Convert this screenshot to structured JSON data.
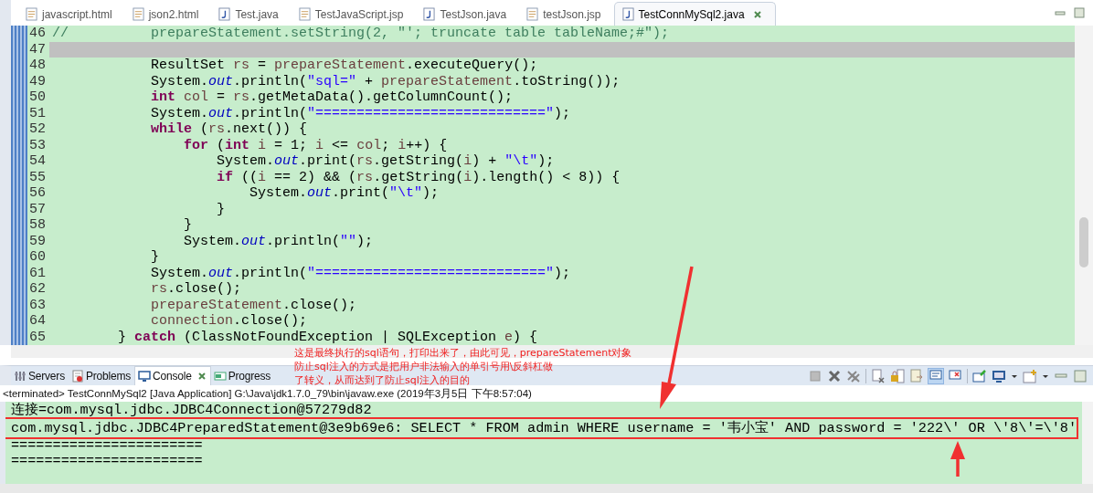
{
  "editor_tabs": [
    {
      "label": "javascript.html",
      "kind": "web",
      "selected": false
    },
    {
      "label": "json2.html",
      "kind": "web",
      "selected": false
    },
    {
      "label": "Test.java",
      "kind": "java",
      "selected": false
    },
    {
      "label": "TestJavaScript.jsp",
      "kind": "web",
      "selected": false
    },
    {
      "label": "TestJson.java",
      "kind": "java",
      "selected": false
    },
    {
      "label": "testJson.jsp",
      "kind": "web",
      "selected": false
    },
    {
      "label": "TestConnMySql2.java",
      "kind": "java",
      "selected": true
    }
  ],
  "code_lines": [
    {
      "number": "46",
      "current": false,
      "tokens": [
        {
          "kind": "comment",
          "text": "//          prepareStatement.setString(2, \"'; truncate table tableName;#\");"
        }
      ]
    },
    {
      "number": "47",
      "current": true
    },
    {
      "number": "48",
      "current": false,
      "tokens": [
        {
          "kind": "plain",
          "text": "            ResultSet "
        },
        {
          "kind": "var",
          "text": "rs"
        },
        {
          "kind": "plain",
          "text": " = "
        },
        {
          "kind": "var",
          "text": "prepareStatement"
        },
        {
          "kind": "plain",
          "text": ".executeQuery();"
        }
      ]
    },
    {
      "number": "49",
      "current": false,
      "tokens": [
        {
          "kind": "plain",
          "text": "            System."
        },
        {
          "kind": "field",
          "text": "out"
        },
        {
          "kind": "plain",
          "text": ".println("
        },
        {
          "kind": "string",
          "text": "\"sql=\""
        },
        {
          "kind": "plain",
          "text": " + "
        },
        {
          "kind": "var",
          "text": "prepareStatement"
        },
        {
          "kind": "plain",
          "text": ".toString());"
        }
      ]
    },
    {
      "number": "50",
      "current": false,
      "tokens": [
        {
          "kind": "keyword",
          "text": "            int"
        },
        {
          "kind": "var",
          "text": " col"
        },
        {
          "kind": "plain",
          "text": " = "
        },
        {
          "kind": "var",
          "text": "rs"
        },
        {
          "kind": "plain",
          "text": ".getMetaData().getColumnCount();"
        }
      ]
    },
    {
      "number": "51",
      "current": false,
      "tokens": [
        {
          "kind": "plain",
          "text": "            System."
        },
        {
          "kind": "field",
          "text": "out"
        },
        {
          "kind": "plain",
          "text": ".println("
        },
        {
          "kind": "string",
          "text": "\"============================\""
        },
        {
          "kind": "plain",
          "text": ");"
        }
      ]
    },
    {
      "number": "52",
      "current": false,
      "tokens": [
        {
          "kind": "keyword",
          "text": "            while"
        },
        {
          "kind": "plain",
          "text": " ("
        },
        {
          "kind": "var",
          "text": "rs"
        },
        {
          "kind": "plain",
          "text": ".next()) {"
        }
      ]
    },
    {
      "number": "53",
      "current": false,
      "tokens": [
        {
          "kind": "keyword",
          "text": "                for"
        },
        {
          "kind": "plain",
          "text": " ("
        },
        {
          "kind": "keyword",
          "text": "int"
        },
        {
          "kind": "var",
          "text": " i"
        },
        {
          "kind": "plain",
          "text": " = 1; "
        },
        {
          "kind": "var",
          "text": "i"
        },
        {
          "kind": "plain",
          "text": " <= "
        },
        {
          "kind": "var",
          "text": "col"
        },
        {
          "kind": "plain",
          "text": "; "
        },
        {
          "kind": "var",
          "text": "i"
        },
        {
          "kind": "plain",
          "text": "++) {"
        }
      ]
    },
    {
      "number": "54",
      "current": false,
      "tokens": [
        {
          "kind": "plain",
          "text": "                    System."
        },
        {
          "kind": "field",
          "text": "out"
        },
        {
          "kind": "plain",
          "text": ".print("
        },
        {
          "kind": "var",
          "text": "rs"
        },
        {
          "kind": "plain",
          "text": ".getString("
        },
        {
          "kind": "var",
          "text": "i"
        },
        {
          "kind": "plain",
          "text": ") + "
        },
        {
          "kind": "string",
          "text": "\"\\t\""
        },
        {
          "kind": "plain",
          "text": ");"
        }
      ]
    },
    {
      "number": "55",
      "current": false,
      "tokens": [
        {
          "kind": "keyword",
          "text": "                    if"
        },
        {
          "kind": "plain",
          "text": " (("
        },
        {
          "kind": "var",
          "text": "i"
        },
        {
          "kind": "plain",
          "text": " == 2) && ("
        },
        {
          "kind": "var",
          "text": "rs"
        },
        {
          "kind": "plain",
          "text": ".getString("
        },
        {
          "kind": "var",
          "text": "i"
        },
        {
          "kind": "plain",
          "text": ").length() < 8)) {"
        }
      ]
    },
    {
      "number": "56",
      "current": false,
      "tokens": [
        {
          "kind": "plain",
          "text": "                        System."
        },
        {
          "kind": "field",
          "text": "out"
        },
        {
          "kind": "plain",
          "text": ".print("
        },
        {
          "kind": "string",
          "text": "\"\\t\""
        },
        {
          "kind": "plain",
          "text": ");"
        }
      ]
    },
    {
      "number": "57",
      "current": false,
      "tokens": [
        {
          "kind": "plain",
          "text": "                    }"
        }
      ]
    },
    {
      "number": "58",
      "current": false,
      "tokens": [
        {
          "kind": "plain",
          "text": "                }"
        }
      ]
    },
    {
      "number": "59",
      "current": false,
      "tokens": [
        {
          "kind": "plain",
          "text": "                System."
        },
        {
          "kind": "field",
          "text": "out"
        },
        {
          "kind": "plain",
          "text": ".println("
        },
        {
          "kind": "string",
          "text": "\"\""
        },
        {
          "kind": "plain",
          "text": ");"
        }
      ]
    },
    {
      "number": "60",
      "current": false,
      "tokens": [
        {
          "kind": "plain",
          "text": "            }"
        }
      ]
    },
    {
      "number": "61",
      "current": false,
      "tokens": [
        {
          "kind": "plain",
          "text": "            System."
        },
        {
          "kind": "field",
          "text": "out"
        },
        {
          "kind": "plain",
          "text": ".println("
        },
        {
          "kind": "string",
          "text": "\"============================\""
        },
        {
          "kind": "plain",
          "text": ");"
        }
      ]
    },
    {
      "number": "62",
      "current": false,
      "tokens": [
        {
          "kind": "var",
          "text": "            rs"
        },
        {
          "kind": "plain",
          "text": ".close();"
        }
      ]
    },
    {
      "number": "63",
      "current": false,
      "tokens": [
        {
          "kind": "var",
          "text": "            prepareStatement"
        },
        {
          "kind": "plain",
          "text": ".close();"
        }
      ]
    },
    {
      "number": "64",
      "current": false,
      "tokens": [
        {
          "kind": "var",
          "text": "            connection"
        },
        {
          "kind": "plain",
          "text": ".close();"
        }
      ]
    },
    {
      "number": "65",
      "current": false,
      "tokens": [
        {
          "kind": "plain",
          "text": "        } "
        },
        {
          "kind": "keyword",
          "text": "catch"
        },
        {
          "kind": "plain",
          "text": " (ClassNotFoundException | SQLException "
        },
        {
          "kind": "var",
          "text": "e"
        },
        {
          "kind": "plain",
          "text": ") {"
        }
      ]
    }
  ],
  "view_tabs": [
    {
      "label": "Servers",
      "kind": "servers",
      "selected": false
    },
    {
      "label": "Problems",
      "kind": "problems",
      "selected": false
    },
    {
      "label": "Console",
      "kind": "console",
      "selected": true
    },
    {
      "label": "Progress",
      "kind": "progress",
      "selected": false
    }
  ],
  "console_status": "<terminated> TestConnMySql2 [Java Application] G:\\Java\\jdk1.7.0_79\\bin\\javaw.exe (2019年3月5日 下午8:57:04)",
  "console_lines": [
    {
      "text": "连接=com.mysql.jdbc.JDBC4Connection@57279d82",
      "boxed": false
    },
    {
      "text": "com.mysql.jdbc.JDBC4PreparedStatement@3e9b69e6: SELECT * FROM admin WHERE username = '韦小宝' AND password = '222\\' OR \\'8\\'=\\'8'",
      "boxed": true
    },
    {
      "text": "=======================",
      "boxed": false
    },
    {
      "text": "=======================",
      "boxed": false
    }
  ],
  "annotation": [
    "这是最终执行的sql语句，打印出来了，由此可见，prepareStatement对象",
    "防止sql注入的方式是把用户非法输入的单引号用\\反斜杠做",
    "了转义，从而达到了防止sql注入的目的"
  ]
}
